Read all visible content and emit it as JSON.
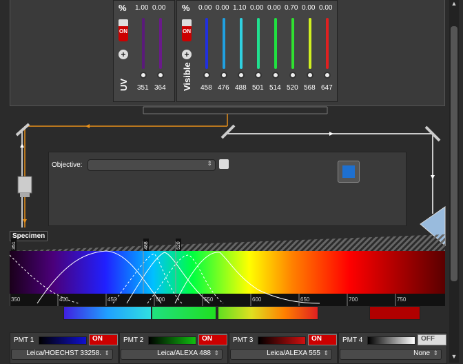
{
  "uv": {
    "label": "UV",
    "percent_label": "%",
    "on_label": "ON",
    "plus_label": "+",
    "lasers": [
      {
        "value": "1.00",
        "wavelength": "351",
        "color": "#5a1a7a"
      },
      {
        "value": "0.00",
        "wavelength": "364",
        "color": "#6a1a8a"
      }
    ]
  },
  "visible": {
    "label": "Visible",
    "percent_label": "%",
    "on_label": "ON",
    "plus_label": "+",
    "lasers": [
      {
        "value": "0.00",
        "wavelength": "458",
        "color": "#2030e0"
      },
      {
        "value": "0.00",
        "wavelength": "476",
        "color": "#20a0e0"
      },
      {
        "value": "1.10",
        "wavelength": "488",
        "color": "#30d0e0"
      },
      {
        "value": "0.00",
        "wavelength": "501",
        "color": "#20e090"
      },
      {
        "value": "0.00",
        "wavelength": "514",
        "color": "#20e040"
      },
      {
        "value": "0.70",
        "wavelength": "520",
        "color": "#30e030"
      },
      {
        "value": "0.00",
        "wavelength": "568",
        "color": "#d0f020"
      },
      {
        "value": "0.00",
        "wavelength": "647",
        "color": "#e02020"
      }
    ]
  },
  "objective": {
    "label": "Objective:",
    "value": ""
  },
  "specimen_label": "Specimen",
  "spectrum": {
    "markers": [
      "351",
      "488",
      "520"
    ],
    "ticks": [
      "350",
      "400",
      "450",
      "500",
      "550",
      "600",
      "650",
      "700",
      "750"
    ]
  },
  "pmts": [
    {
      "name": "PMT 1",
      "toggle": "ON",
      "dye": "Leica/HOECHST 33258.",
      "color": "#1010d0"
    },
    {
      "name": "PMT 2",
      "toggle": "ON",
      "dye": "Leica/ALEXA 488",
      "color": "#10c010"
    },
    {
      "name": "PMT 3",
      "toggle": "ON",
      "dye": "Leica/ALEXA 555",
      "color": "#d01010"
    },
    {
      "name": "PMT 4",
      "toggle": "OFF",
      "dye": "None",
      "color": "#ffffff"
    }
  ]
}
